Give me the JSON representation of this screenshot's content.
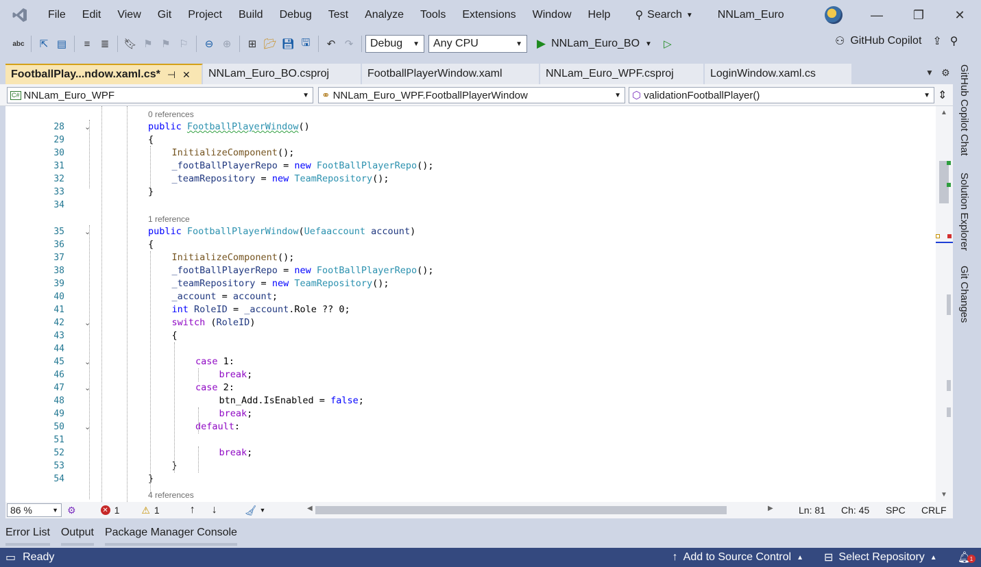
{
  "menu": {
    "items": [
      "File",
      "Edit",
      "View",
      "Git",
      "Project",
      "Build",
      "Debug",
      "Test",
      "Analyze",
      "Tools",
      "Extensions",
      "Window",
      "Help"
    ],
    "search_label": "Search",
    "solution_name": "NNLam_Euro"
  },
  "toolbar": {
    "configuration": "Debug",
    "platform": "Any CPU",
    "startup_project": "NNLam_Euro_BO",
    "copilot_label": "GitHub Copilot"
  },
  "tabs": [
    {
      "label": "FootballPlay...ndow.xaml.cs*",
      "active": true
    },
    {
      "label": "NNLam_Euro_BO.csproj",
      "active": false
    },
    {
      "label": "FootballPlayerWindow.xaml",
      "active": false
    },
    {
      "label": "NNLam_Euro_WPF.csproj",
      "active": false
    },
    {
      "label": "LoginWindow.xaml.cs",
      "active": false
    }
  ],
  "navbar": {
    "project": "NNLam_Euro_WPF",
    "type": "NNLam_Euro_WPF.FootballPlayerWindow",
    "member": "validationFootballPlayer()"
  },
  "editor": {
    "lines": [
      {
        "n": "28",
        "fold": true,
        "indent": 0,
        "html": "<span class='kw'>public</span> <span class='ty squiggle'>FootballPlayerWindow</span>()"
      },
      {
        "n": "29",
        "fold": false,
        "indent": 0,
        "html": "{"
      },
      {
        "n": "30",
        "fold": false,
        "indent": 1,
        "html": "<span class='mt'>InitializeComponent</span>();"
      },
      {
        "n": "31",
        "fold": false,
        "indent": 1,
        "html": "<span class='va'>_footBallPlayerRepo</span> = <span class='kw'>new</span> <span class='ty'>FootBallPlayerRepo</span>();"
      },
      {
        "n": "32",
        "fold": false,
        "indent": 1,
        "html": "<span class='va'>_teamRepository</span> = <span class='kw'>new</span> <span class='ty'>TeamRepository</span>();"
      },
      {
        "n": "33",
        "fold": false,
        "indent": 0,
        "html": "}"
      },
      {
        "n": "34",
        "fold": false,
        "indent": 0,
        "html": ""
      },
      {
        "n": "35",
        "fold": true,
        "indent": 0,
        "html": "<span class='kw'>public</span> <span class='ty'>FootballPlayerWindow</span>(<span class='ty'>Uefaaccount</span> <span class='va'>account</span>)"
      },
      {
        "n": "36",
        "fold": false,
        "indent": 0,
        "html": "{"
      },
      {
        "n": "37",
        "fold": false,
        "indent": 1,
        "html": "<span class='mt'>InitializeComponent</span>();"
      },
      {
        "n": "38",
        "fold": false,
        "indent": 1,
        "html": "<span class='va'>_footBallPlayerRepo</span> = <span class='kw'>new</span> <span class='ty'>FootBallPlayerRepo</span>();"
      },
      {
        "n": "39",
        "fold": false,
        "indent": 1,
        "html": "<span class='va'>_teamRepository</span> = <span class='kw'>new</span> <span class='ty'>TeamRepository</span>();"
      },
      {
        "n": "40",
        "fold": false,
        "indent": 1,
        "html": "<span class='va'>_account</span> = <span class='va'>account</span>;"
      },
      {
        "n": "41",
        "fold": false,
        "indent": 1,
        "html": "<span class='kw'>int</span> <span class='va'>RoleID</span> = <span class='va'>_account</span>.Role ?? 0;"
      },
      {
        "n": "42",
        "fold": true,
        "indent": 1,
        "html": "<span class='kw2'>switch</span> (<span class='va'>RoleID</span>)"
      },
      {
        "n": "43",
        "fold": false,
        "indent": 1,
        "html": "{"
      },
      {
        "n": "44",
        "fold": false,
        "indent": 2,
        "html": ""
      },
      {
        "n": "45",
        "fold": true,
        "indent": 2,
        "html": "<span class='kw2'>case</span> 1:"
      },
      {
        "n": "46",
        "fold": false,
        "indent": 3,
        "html": "<span class='kw2'>break</span>;"
      },
      {
        "n": "47",
        "fold": true,
        "indent": 2,
        "html": "<span class='kw2'>case</span> 2:"
      },
      {
        "n": "48",
        "fold": false,
        "indent": 3,
        "html": "btn_Add.IsEnabled = <span class='kw'>false</span>;"
      },
      {
        "n": "49",
        "fold": false,
        "indent": 3,
        "html": "<span class='kw2'>break</span>;"
      },
      {
        "n": "50",
        "fold": true,
        "indent": 2,
        "html": "<span class='kw2'>default</span>:"
      },
      {
        "n": "51",
        "fold": false,
        "indent": 3,
        "html": ""
      },
      {
        "n": "52",
        "fold": false,
        "indent": 3,
        "html": "<span class='kw2'>break</span>;"
      },
      {
        "n": "53",
        "fold": false,
        "indent": 1,
        "html": "}"
      },
      {
        "n": "54",
        "fold": false,
        "indent": 0,
        "html": "}"
      }
    ],
    "codelens": [
      "0 references",
      "1 reference",
      "4 references"
    ]
  },
  "edstatus": {
    "zoom": "86 %",
    "errors": "1",
    "warnings": "1",
    "line": "Ln: 81",
    "col": "Ch: 45",
    "spacing": "SPC",
    "eol": "CRLF"
  },
  "side_tabs": [
    "GitHub Copilot Chat",
    "Solution Explorer",
    "Git Changes"
  ],
  "tool_tabs": [
    "Error List",
    "Output",
    "Package Manager Console"
  ],
  "statusbar": {
    "ready": "Ready",
    "source_control": "Add to Source Control",
    "repository": "Select Repository",
    "notifications": "1"
  }
}
